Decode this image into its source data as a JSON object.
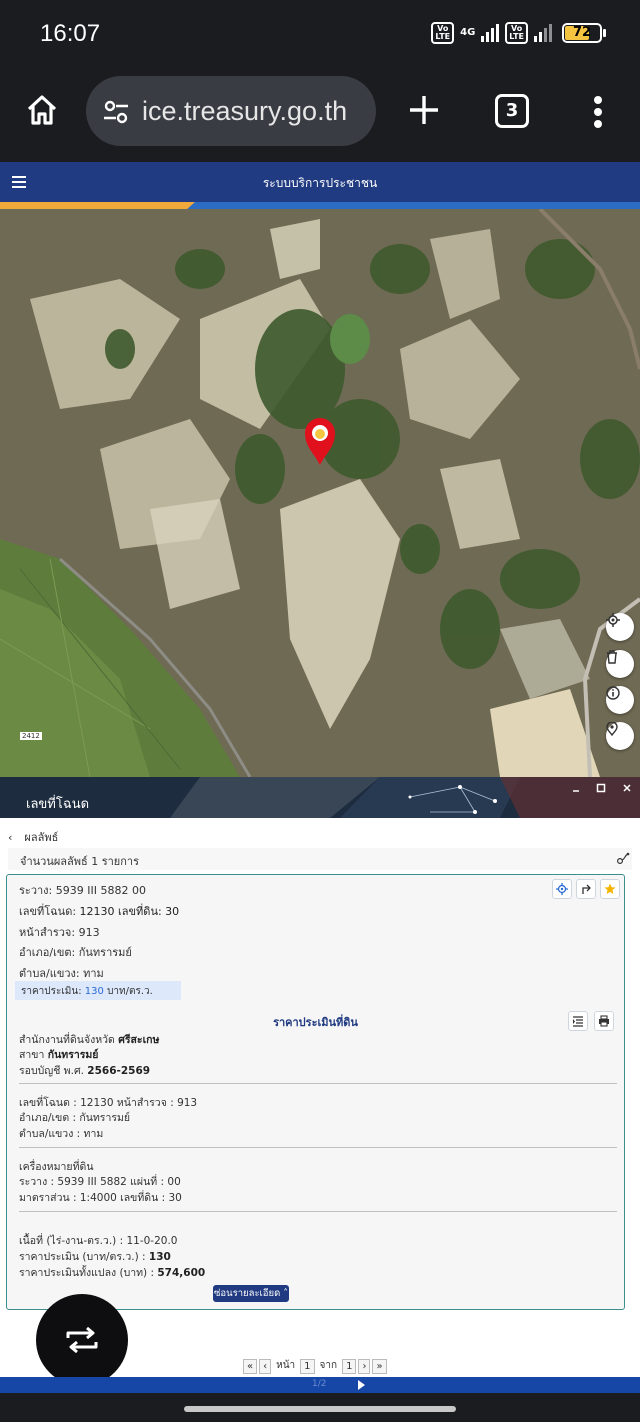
{
  "status_bar": {
    "time": "16:07",
    "volte1": "Vo\nLTE",
    "network": "4G",
    "volte2": "Vo\nLTE",
    "battery": "72"
  },
  "browser": {
    "url": "ice.treasury.go.th",
    "tab_count": "3"
  },
  "site": {
    "title": "ระบบบริการประชาชน"
  },
  "map": {
    "road_label": "2412",
    "controls": [
      "locate-icon",
      "trash-icon",
      "info-icon",
      "pin-icon"
    ]
  },
  "panel": {
    "title": "เลขที่โฉนด",
    "back_label": "ผลลัพธ์",
    "count_text": "จำนวนผลลัพธ์ 1 รายการ",
    "card": {
      "rawang": "ระวาง: 5939 III 5882 00",
      "deed_line_label": "เลขที่โฉนด:",
      "deed_line_value": "12130 เลขที่ดิน: 30",
      "survey": "หน้าสำรวจ: 913",
      "district": "อำเภอ/เขต: กันทรารมย์",
      "subdistrict": "ตำบล/แขวง: ทาม",
      "price_label": "ราคาประเมิน:",
      "price_value": "130",
      "price_unit": "บาท/ตร.ว."
    },
    "appraisal": {
      "title": "ราคาประเมินที่ดิน",
      "office_label": "สำนักงานที่ดินจังหวัด",
      "office_value": "ศรีสะเกษ",
      "branch_label": "สาขา",
      "branch_value": "กันทรารมย์",
      "cycle_label": "รอบบัญชี พ.ศ.",
      "cycle_value": "2566-2569",
      "deed_survey": "เลขที่โฉนด : 12130 หน้าสำรวจ : 913",
      "district": "อำเภอ/เขต : กันทรารมย์",
      "subdistrict": "ตำบล/แขวง : ทาม",
      "marker_title": "เครื่องหมายที่ดิน",
      "marker_rawang": "ระวาง : 5939 III 5882 แผ่นที่ : 00",
      "marker_scale": "มาตราส่วน : 1:4000 เลขที่ดิน : 30",
      "area": "เนื้อที่ (ไร่-งาน-ตร.ว.) : 11-0-20.0",
      "price_label": "ราคาประเมิน (บาท/ตร.ว.) :",
      "price_value": "130",
      "total_label": "ราคาประเมินทั้งแปลง (บาท) :",
      "total_value": "574,600",
      "hide_button": "ซ่อนรายละเอียด"
    },
    "pager": {
      "first": "«",
      "prev": "‹",
      "page_label": "หน้า",
      "page": "1",
      "of_label": "จาก",
      "total": "1",
      "next": "›",
      "last": "»"
    }
  },
  "bottom_bar": {
    "ghost_text": "1/2"
  },
  "colors": {
    "header_blue": "#213b82",
    "accent_orange": "#f2a93b",
    "accent_blue": "#2b6cc4",
    "pin_red": "#e0101c",
    "card_border": "#3c8f8f"
  }
}
